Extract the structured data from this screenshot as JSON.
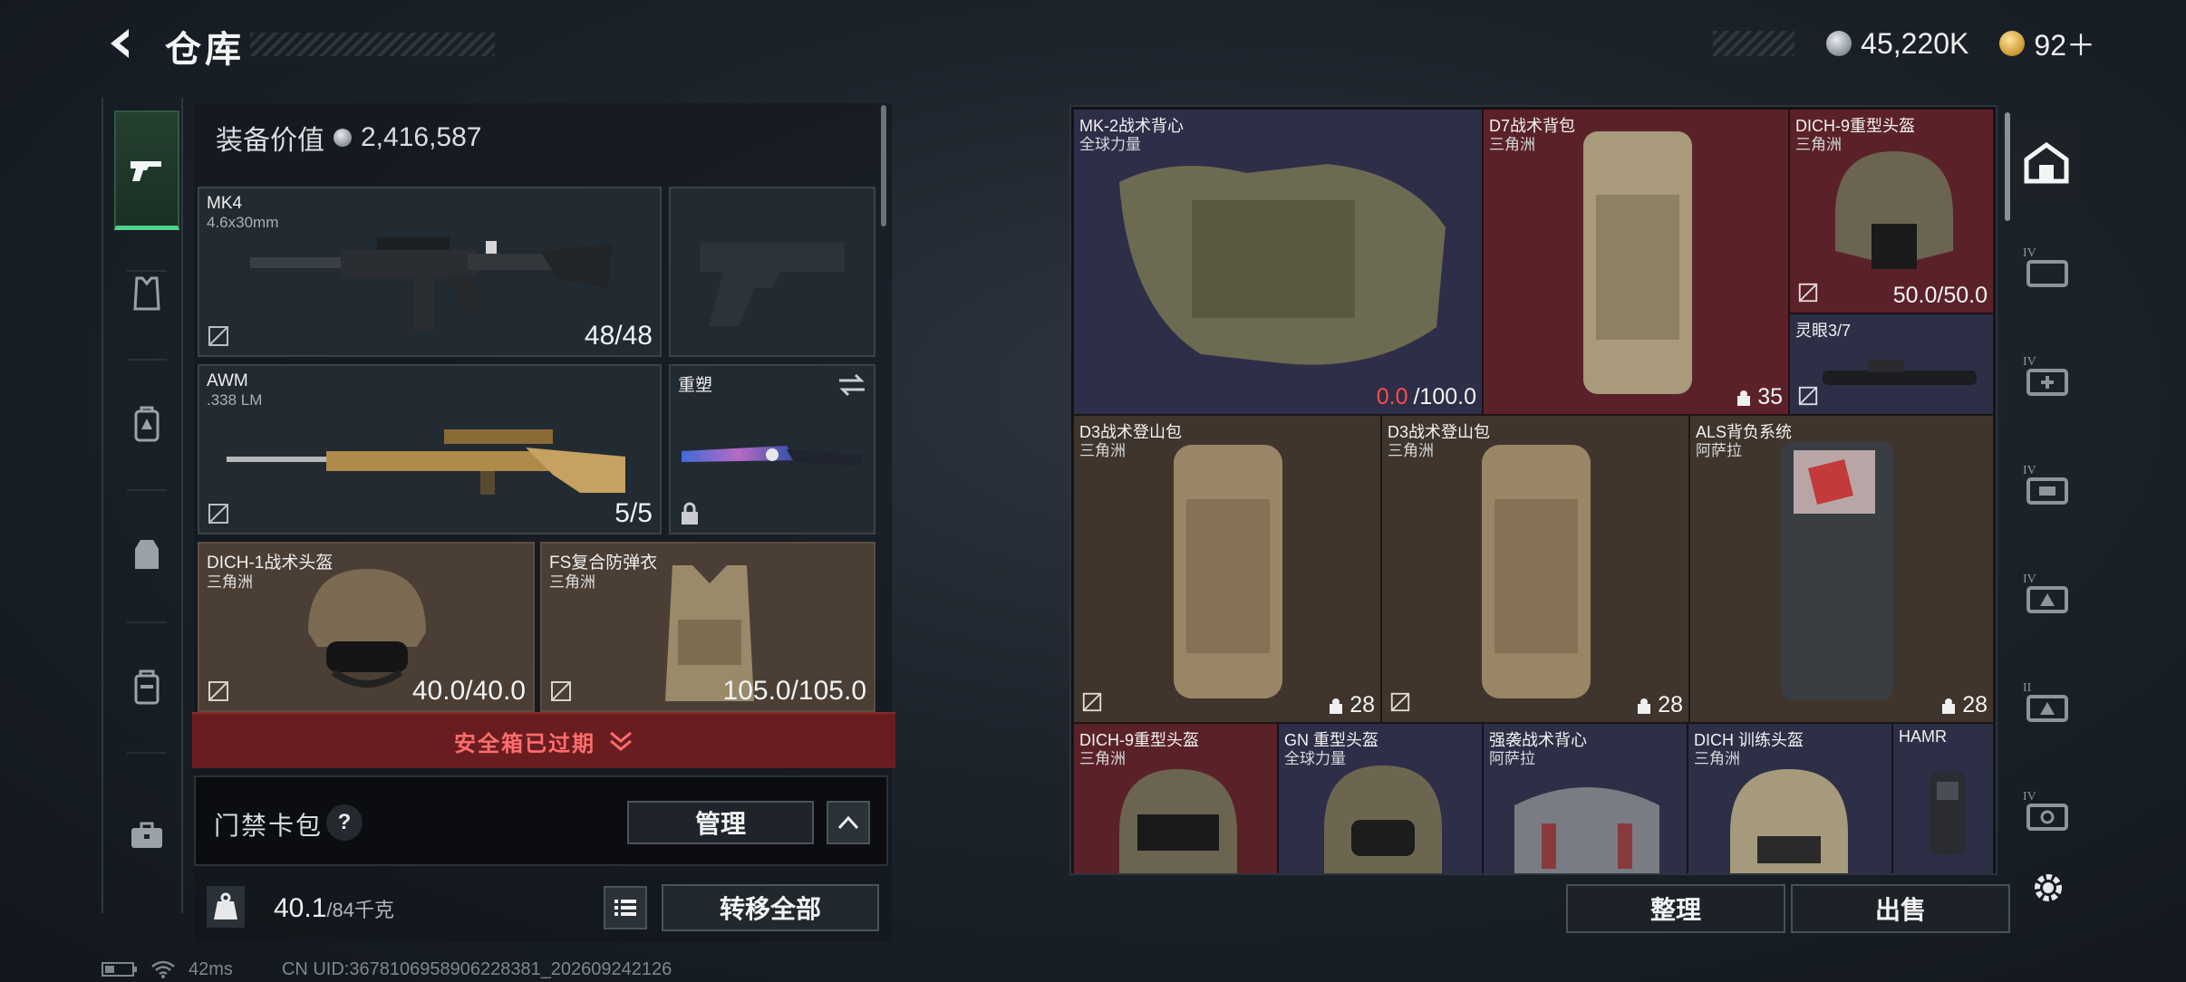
{
  "header": {
    "title": "仓库"
  },
  "currency": {
    "silver": "45,220K",
    "gold": "92＋"
  },
  "equip": {
    "value_label": "装备价值",
    "value": "2,416,587",
    "primary": {
      "name": "MK4",
      "caliber": "4.6x30mm",
      "ammo": "48/48"
    },
    "secondary": {
      "name": "AWM",
      "caliber": ".338 LM",
      "ammo": "5/5"
    },
    "melee": {
      "name": "重塑"
    },
    "helmet": {
      "name": "DICH-1战术头盔",
      "org": "三角洲",
      "durability": "40.0/40.0"
    },
    "armor": {
      "name": "FS复合防弹衣",
      "org": "三角洲",
      "durability": "105.0/105.0"
    }
  },
  "safebox": {
    "label": "安全箱已过期"
  },
  "keycard": {
    "label": "门禁卡包",
    "help": "?",
    "manage": "管理"
  },
  "weight": {
    "current": "40.1",
    "max": "/84千克"
  },
  "actions": {
    "transfer_all": "转移全部",
    "sort": "整理",
    "sell": "出售"
  },
  "stash": {
    "items": [
      {
        "name": "MK-2战术背心",
        "org": "全球力量",
        "dur_current": "0.0",
        "dur_max": "/100.0"
      },
      {
        "name": "D7战术背包",
        "org": "三角洲",
        "count": "35"
      },
      {
        "name": "DICH-9重型头盔",
        "org": "三角洲",
        "durability": "50.0/50.0"
      },
      {
        "name": "灵眼3/7"
      },
      {
        "name": "D3战术登山包",
        "org": "三角洲",
        "count": "28"
      },
      {
        "name": "D3战术登山包",
        "org": "三角洲",
        "count": "28"
      },
      {
        "name": "ALS背负系统",
        "org": "阿萨拉",
        "count": "28"
      },
      {
        "name": "DICH-9重型头盔",
        "org": "三角洲"
      },
      {
        "name": "GN 重型头盔",
        "org": "全球力量"
      },
      {
        "name": "强袭战术背心",
        "org": "阿萨拉"
      },
      {
        "name": "DICH 训练头盔",
        "org": "三角洲"
      },
      {
        "name": "HAMR"
      }
    ]
  },
  "right_tabs": [
    "IV",
    "IV",
    "IV",
    "IV",
    "II",
    "IV"
  ],
  "status": {
    "ping": "42ms",
    "uid": "CN UID:3678106958906228381_202609242126"
  },
  "colors": {
    "accent_green": "#4fd28a",
    "danger_red": "#ff4a4a",
    "safebox_bg": "#6a1d20"
  }
}
